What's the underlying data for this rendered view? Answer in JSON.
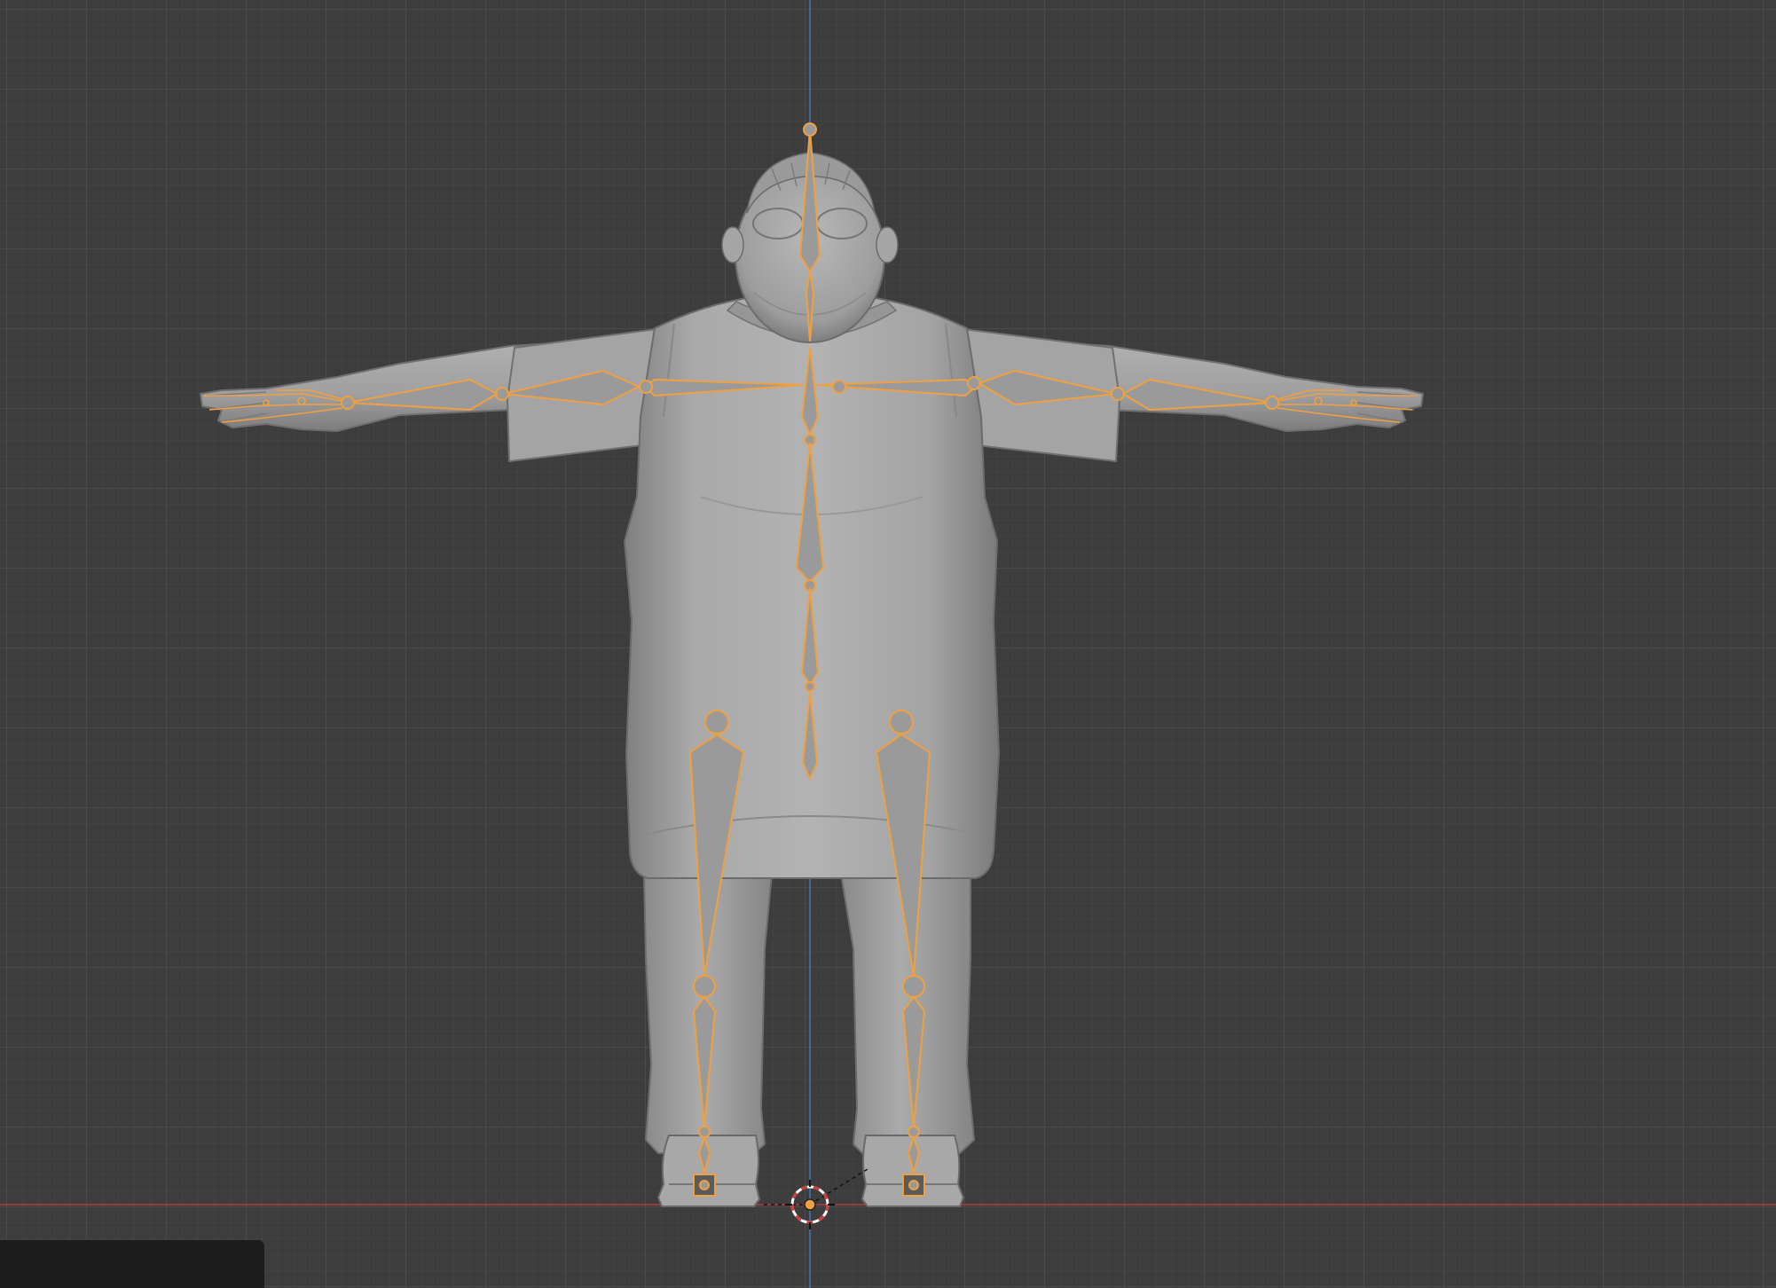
{
  "viewport": {
    "background": "#3d3d3d",
    "grid_minor_color": "#474747",
    "grid_major_color": "#525252",
    "x_axis_color": "#b83a44",
    "z_axis_color": "#3e73b0",
    "mesh_color": "#a2a2a2",
    "mesh_shadow_color": "#6e6e6e",
    "bone_fill_color": "#9a9a9a",
    "bone_outline_color": "#f0a040",
    "origin_color": "#f0a040",
    "cursor_ring_colors": [
      "#d23b3b",
      "#ffffff"
    ]
  },
  "corner_panel": {
    "color": "#1d1d1d"
  },
  "icons": {
    "armature": "armature-bones",
    "object_origin": "origin-dot",
    "cursor": "3d-cursor-icon"
  }
}
